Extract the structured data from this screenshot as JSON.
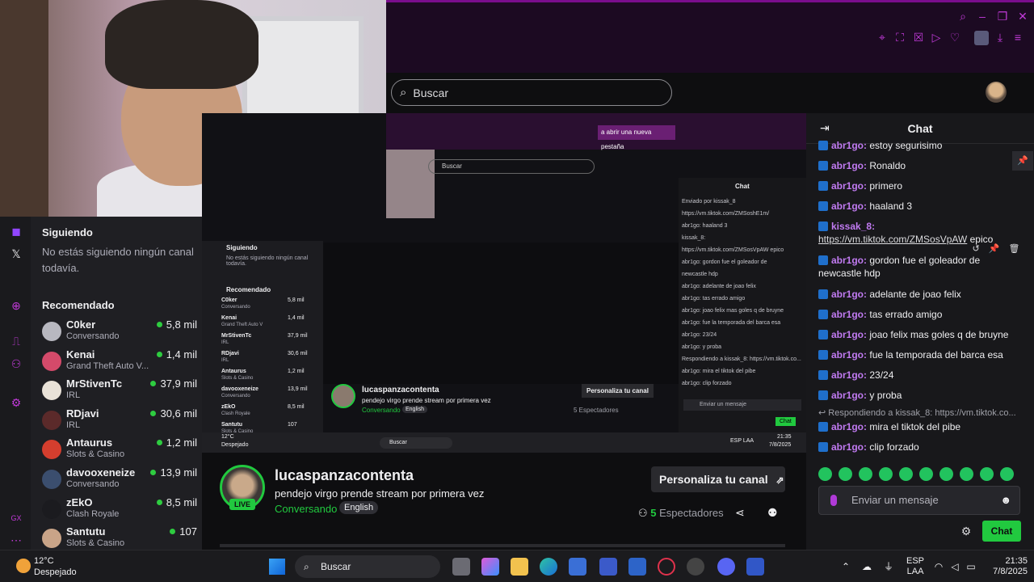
{
  "browser": {
    "search_placeholder": "Buscar"
  },
  "sidebar": {
    "following_heading": "Siguiendo",
    "following_empty": "No estás siguiendo ningún canal todavía.",
    "recommended_heading": "Recomendado",
    "channels": [
      {
        "name": "C0ker",
        "category": "Conversando",
        "viewers": "5,8 mil",
        "color": "#b8b8c0"
      },
      {
        "name": "Kenai",
        "category": "Grand Theft Auto V...",
        "viewers": "1,4 mil",
        "color": "#d44a6a"
      },
      {
        "name": "MrStivenTc",
        "category": "IRL",
        "viewers": "37,9 mil",
        "color": "#e9e2d8"
      },
      {
        "name": "RDjavi",
        "category": "IRL",
        "viewers": "30,6 mil",
        "color": "#5b2a2a"
      },
      {
        "name": "Antaurus",
        "category": "Slots & Casino",
        "viewers": "1,2 mil",
        "color": "#d43e2e"
      },
      {
        "name": "davooxeneize",
        "category": "Conversando",
        "viewers": "13,9 mil",
        "color": "#3b4e6e"
      },
      {
        "name": "zEkO",
        "category": "Clash Royale",
        "viewers": "8,5 mil",
        "color": "#1b1b1f"
      },
      {
        "name": "Santutu",
        "category": "Slots & Casino",
        "viewers": "107",
        "color": "#c9a488"
      }
    ]
  },
  "nested": {
    "tab_text": "a abrir una nueva pestaña",
    "search": "Buscar",
    "sidebar_following": "Siguiendo",
    "sidebar_note": "No estás siguiendo ningún canal todavía.",
    "sidebar_recommended": "Recomendado",
    "sidebar_rows": [
      {
        "name": "C0ker",
        "cat": "Conversando",
        "v": "5,8 mil"
      },
      {
        "name": "Kenai",
        "cat": "Grand Theft Auto V",
        "v": "1,4 mil"
      },
      {
        "name": "MrStivenTc",
        "cat": "IRL",
        "v": "37,9 mil"
      },
      {
        "name": "RDjavi",
        "cat": "IRL",
        "v": "30,6 mil"
      },
      {
        "name": "Antaurus",
        "cat": "Slots & Casino",
        "v": "1,2 mil"
      },
      {
        "name": "davooxeneize",
        "cat": "Conversando",
        "v": "13,9 mil"
      },
      {
        "name": "zEkO",
        "cat": "Clash Royale",
        "v": "8,5 mil"
      },
      {
        "name": "Santutu",
        "cat": "Slots & Casino",
        "v": "107"
      }
    ],
    "chat_title": "Chat",
    "chat_lines": [
      "Enviado por kissak_8",
      "https://vm.tiktok.com/ZMSoshE1m/",
      "abr1go: haaland 3",
      "kissak_8:",
      "https://vm.tiktok.com/ZMSosVpAW epico",
      "abr1go: gordon fue el goleador de",
      "newcastle hdp",
      "abr1go: adelante de joao felix",
      "abr1go: tas errado amigo",
      "abr1go: joao felix mas goles q de bruyne",
      "abr1go: fue la temporada del barca esa",
      "abr1go: 23/24",
      "abr1go: y proba",
      "Respondiendo a kissak_8: https://vm.tiktok.co...",
      "abr1go: mira el tiktok del pibe",
      "abr1go: clip forzado"
    ],
    "chat_input": "Enviar un mensaje",
    "chat_button": "Chat",
    "streamer": "lucaspanzacontenta",
    "title": "pendejo virgo prende stream por primera vez",
    "category": "Conversando",
    "tag": "English",
    "customize": "Personaliza tu canal",
    "viewers": "5 Espectadores",
    "taskbar_search": "Buscar",
    "temp": "12°C",
    "weather": "Despejado",
    "lang": "ESP LAA",
    "time": "21:35",
    "date": "7/8/2025"
  },
  "stream": {
    "streamer_name": "lucaspanzacontenta",
    "title": "pendejo virgo prende stream por primera vez",
    "category": "Conversando",
    "tag": "English",
    "live_label": "LIVE",
    "customize_label": "Personaliza tu canal",
    "viewer_count": "5",
    "viewer_label": "Espectadores"
  },
  "chat": {
    "title": "Chat",
    "messages": [
      {
        "user": "abr1go",
        "text": "estoy segurisimo"
      },
      {
        "user": "abr1go",
        "text": "Ronaldo"
      },
      {
        "user": "abr1go",
        "text": "primero"
      },
      {
        "user": "abr1go",
        "text": "haaland 3"
      },
      {
        "user": "kissak_8",
        "text": "",
        "link": "https://vm.tiktok.com/ZMSosVpAW",
        "after": "epico"
      },
      {
        "user": "abr1go",
        "text": "gordon fue el goleador de newcastle hdp"
      },
      {
        "user": "abr1go",
        "text": "adelante de joao felix"
      },
      {
        "user": "abr1go",
        "text": "tas errado amigo"
      },
      {
        "user": "abr1go",
        "text": "joao felix mas goles q de bruyne"
      },
      {
        "user": "abr1go",
        "text": "fue la temporada del barca esa"
      },
      {
        "user": "abr1go",
        "text": "23/24"
      },
      {
        "user": "abr1go",
        "text": "y proba"
      },
      {
        "user": "abr1go",
        "text": "mira el tiktok del pibe"
      },
      {
        "user": "abr1go",
        "text": "clip forzado"
      }
    ],
    "reply_prefix": "Respondiendo a kissak_8:",
    "reply_link": "https://vm.tiktok.co...",
    "input_placeholder": "Enviar un mensaje",
    "send_label": "Chat"
  },
  "taskbar": {
    "temperature": "12°C",
    "weather": "Despejado",
    "search_label": "Buscar",
    "lang_line1": "ESP",
    "lang_line2": "LAA",
    "time": "21:35",
    "date": "7/8/2025"
  },
  "colors": {
    "accent": "#c13ad8",
    "live_green": "#21c93f",
    "username": "#c17bf2"
  }
}
